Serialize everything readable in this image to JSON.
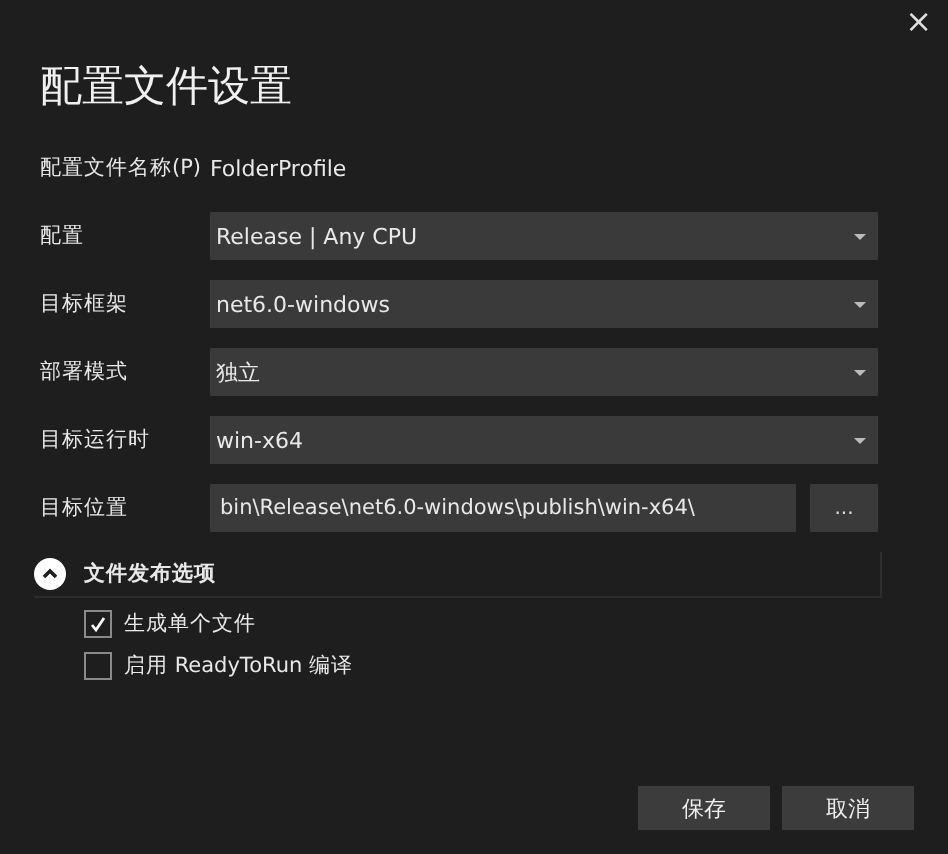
{
  "window": {
    "close": "×",
    "title": "配置文件设置"
  },
  "profile_name": {
    "label": "配置文件名称(P)",
    "value": "FolderProfile"
  },
  "fields": [
    {
      "kind": "dropdown",
      "label": "配置",
      "value": "Release | Any CPU"
    },
    {
      "kind": "dropdown",
      "label": "目标框架",
      "value": "net6.0-windows"
    },
    {
      "kind": "dropdown",
      "label": "部署模式",
      "value": "独立"
    },
    {
      "kind": "dropdown",
      "label": "目标运行时",
      "value": "win-x64"
    },
    {
      "kind": "path",
      "label": "目标位置",
      "value": "bin\\Release\\net6.0-windows\\publish\\win-x64\\",
      "browse": "..."
    }
  ],
  "section": {
    "title": "文件发布选项",
    "expanded": true,
    "options": [
      {
        "label": "生成单个文件",
        "checked": true
      },
      {
        "label": "启用 ReadyToRun 编译",
        "checked": false
      }
    ]
  },
  "buttons": [
    "保存",
    "取消"
  ]
}
